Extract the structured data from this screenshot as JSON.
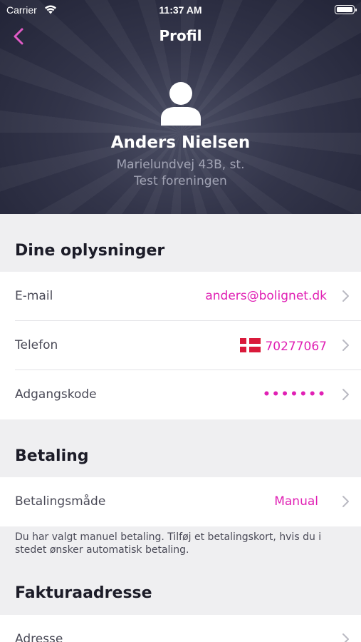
{
  "status_bar": {
    "carrier": "Carrier",
    "time": "11:37 AM"
  },
  "header": {
    "title": "Profil"
  },
  "user": {
    "name": "Anders Nielsen",
    "address": "Marielundvej 43B, st.",
    "association": "Test foreningen"
  },
  "info_section": {
    "title": "Dine oplysninger",
    "rows": [
      {
        "label": "E-mail",
        "value": "anders@bolignet.dk"
      },
      {
        "label": "Telefon",
        "value": "70277067",
        "icon": "denmark-flag-icon"
      },
      {
        "label": "Adgangskode",
        "value": "•••••••"
      }
    ]
  },
  "payment_section": {
    "title": "Betaling",
    "rows": [
      {
        "label": "Betalingsmåde",
        "value": "Manual"
      }
    ],
    "note": "Du har valgt manuel betaling. Tilføj et betalingskort, hvis du i stedet ønsker automatisk betaling."
  },
  "invoice_section": {
    "title": "Fakturaadresse",
    "rows": [
      {
        "label": "Adresse"
      }
    ]
  },
  "colors": {
    "accent": "#e020b4",
    "header_bg": "#2b2d42",
    "background": "#efeff1"
  }
}
